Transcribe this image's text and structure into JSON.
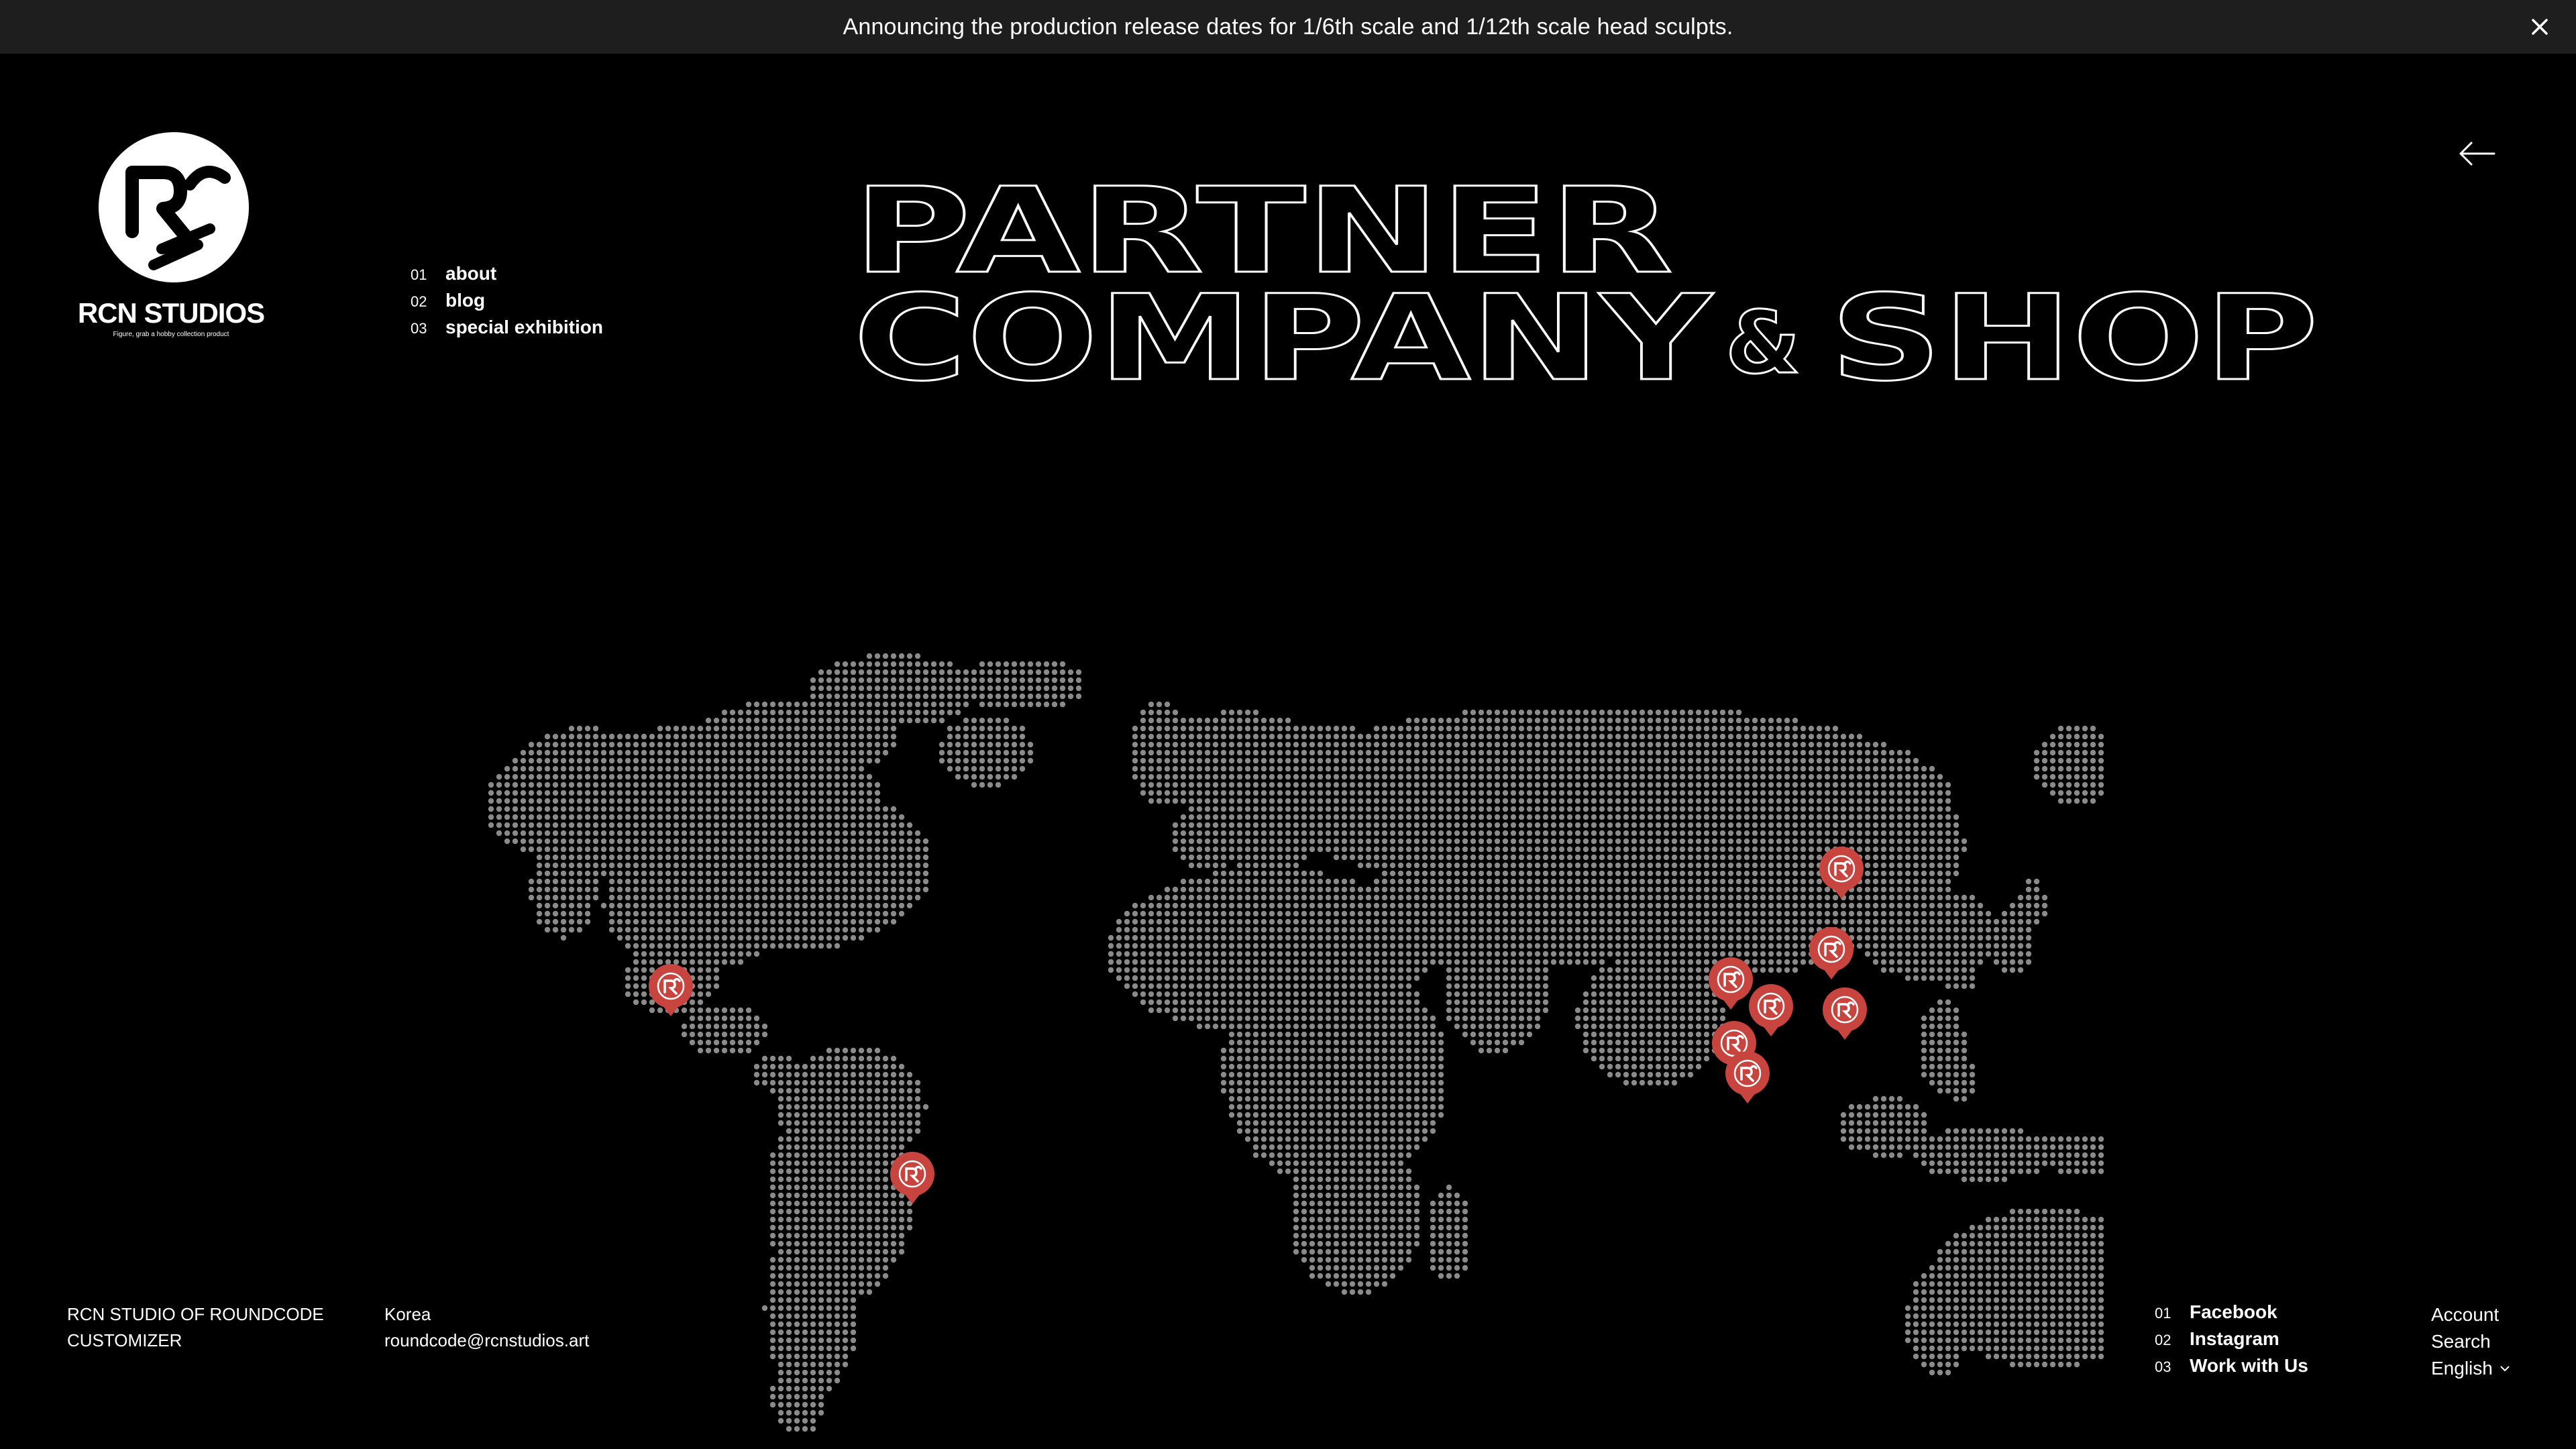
{
  "announcement": {
    "text": "Announcing the production release dates for 1/6th scale and 1/12th scale head sculpts."
  },
  "brand": {
    "name": "RCN STUDIOS",
    "tagline": "Figure, grab a hobby collection product"
  },
  "main_nav": [
    {
      "num": "01",
      "label": "about"
    },
    {
      "num": "02",
      "label": "blog"
    },
    {
      "num": "03",
      "label": "special exhibition"
    }
  ],
  "title": {
    "line1": "PARTNER",
    "line2_a": "COMPANY",
    "line2_amp": "&",
    "line2_b": "SHOP"
  },
  "footer": {
    "company_line1": "RCN STUDIO OF ROUNDCODE",
    "company_line2": "CUSTOMIZER",
    "country": "Korea",
    "email": "roundcode@rcnstudios.art"
  },
  "social_nav": [
    {
      "num": "01",
      "label": "Facebook"
    },
    {
      "num": "02",
      "label": "Instagram"
    },
    {
      "num": "03",
      "label": "Work with Us"
    }
  ],
  "util_nav": {
    "account": "Account",
    "search": "Search",
    "language": "English"
  },
  "map": {
    "dot_color": "#8a8a8a",
    "pin_color": "#c8453f",
    "pins": [
      {
        "region": "mexico",
        "icon": "rcn-logo-icon"
      },
      {
        "region": "brazil",
        "icon": "rcn-logo-icon"
      },
      {
        "region": "korea",
        "icon": "rcn-logo-icon"
      },
      {
        "region": "taiwan",
        "icon": "rcn-logo-icon"
      },
      {
        "region": "thailand",
        "icon": "rcn-logo-icon"
      },
      {
        "region": "vietnam",
        "icon": "rcn-logo-icon"
      },
      {
        "region": "philippines",
        "icon": "rcn-logo-icon"
      },
      {
        "region": "malaysia",
        "icon": "rcn-logo-icon"
      },
      {
        "region": "singapore",
        "icon": "rcn-logo-icon"
      }
    ]
  },
  "colors": {
    "background": "#000000",
    "announcement_bar": "#1e1e1e",
    "text": "#ffffff",
    "accent_pin": "#c8453f"
  }
}
